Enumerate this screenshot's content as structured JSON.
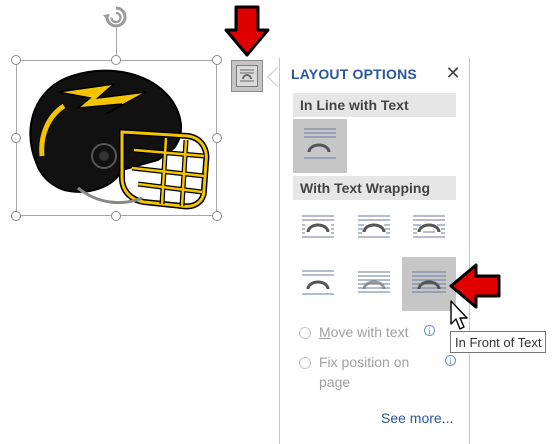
{
  "panel": {
    "title": "LAYOUT OPTIONS",
    "close_glyph": "✕",
    "sections": {
      "inline": "In Line with Text",
      "wrapping": "With Text Wrapping"
    },
    "options": {
      "move_with_text": "Move with text",
      "fix_position_line1": "Fix position on",
      "fix_position_line2": "page",
      "info_glyph": "i"
    },
    "see_more": "See more..."
  },
  "tooltip": "In Front of Text",
  "wrap_options": [
    {
      "name": "square",
      "selected": false
    },
    {
      "name": "tight",
      "selected": false
    },
    {
      "name": "through",
      "selected": false
    },
    {
      "name": "top-and-bottom",
      "selected": false
    },
    {
      "name": "behind-text",
      "selected": false
    },
    {
      "name": "in-front-of-text",
      "selected": true
    }
  ],
  "colors": {
    "accent": "#2b579a",
    "arrow_red": "#e00000",
    "helmet_gold": "#f5c400"
  },
  "icons": [
    "rotate-icon",
    "layout-options-icon",
    "close-icon",
    "info-icon",
    "red-arrow-icon",
    "mouse-cursor-icon",
    "football-helmet-image"
  ]
}
